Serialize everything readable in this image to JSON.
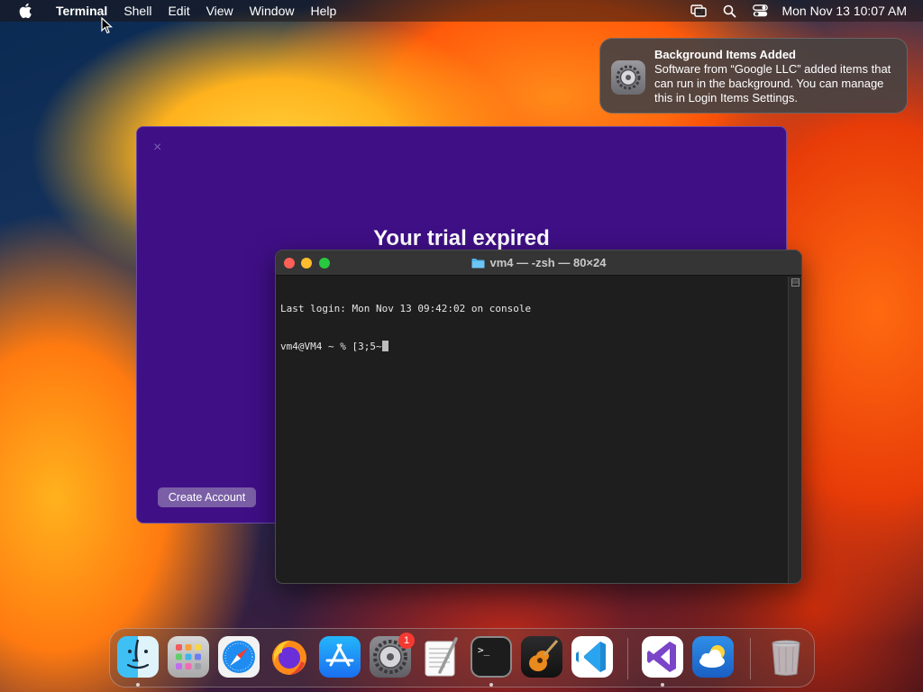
{
  "menubar": {
    "app_name": "Terminal",
    "menus": [
      "Shell",
      "Edit",
      "View",
      "Window",
      "Help"
    ],
    "clock": "Mon Nov 13  10:07 AM"
  },
  "notification": {
    "title": "Background Items Added",
    "body": "Software from “Google LLC” added items that can run in the background. You can manage this in Login Items Settings."
  },
  "trial_window": {
    "title": "Your trial expired",
    "create_account_label": "Create Account",
    "close_glyph": "×"
  },
  "terminal": {
    "window_title": "vm4 — -zsh — 80×24",
    "lines": [
      "Last login: Mon Nov 13 09:42:02 on console",
      "vm4@VM4 ~ % [3;5~"
    ]
  },
  "dock": {
    "settings_badge": "1",
    "apps": [
      "finder",
      "launchpad",
      "safari",
      "firefox",
      "app-store",
      "system-settings",
      "textedit",
      "terminal",
      "garageband",
      "vscode",
      "visual-studio",
      "weather",
      "trash"
    ]
  },
  "colors": {
    "trial_bg": "#3f0f86",
    "terminal_bg": "#1e1e1e",
    "badge": "#f33a32"
  }
}
